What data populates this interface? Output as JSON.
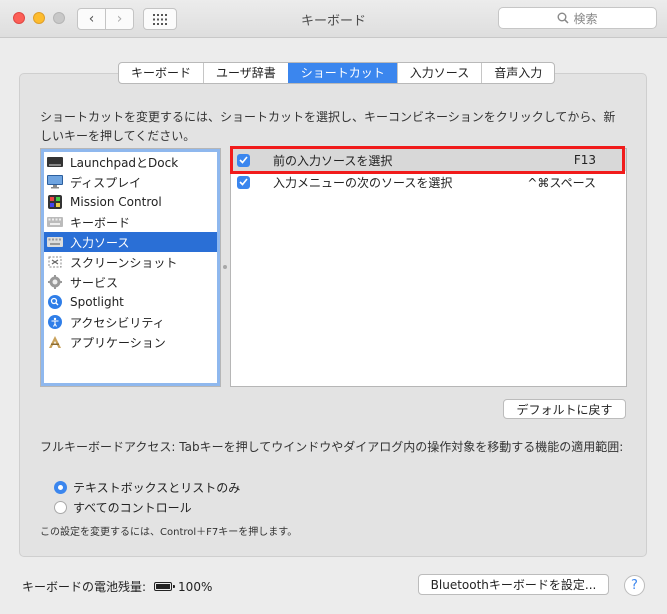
{
  "window": {
    "title": "キーボード",
    "search_placeholder": "検索",
    "nav_back": "‹",
    "nav_forward": "›"
  },
  "tabs": [
    {
      "label": "キーボード",
      "active": false
    },
    {
      "label": "ユーザ辞書",
      "active": false
    },
    {
      "label": "ショートカット",
      "active": true
    },
    {
      "label": "入力ソース",
      "active": false
    },
    {
      "label": "音声入力",
      "active": false
    }
  ],
  "description": "ショートカットを変更するには、ショートカットを選択し、キーコンビネーションをクリックしてから、新しいキーを押してください。",
  "categories": [
    {
      "label": "LaunchpadとDock",
      "icon": "launchpad-icon"
    },
    {
      "label": "ディスプレイ",
      "icon": "display-icon"
    },
    {
      "label": "Mission Control",
      "icon": "mission-control-icon"
    },
    {
      "label": "キーボード",
      "icon": "keyboard-icon"
    },
    {
      "label": "入力ソース",
      "icon": "input-source-icon",
      "selected": true
    },
    {
      "label": "スクリーンショット",
      "icon": "screenshot-icon"
    },
    {
      "label": "サービス",
      "icon": "services-gear-icon"
    },
    {
      "label": "Spotlight",
      "icon": "spotlight-icon"
    },
    {
      "label": "アクセシビリティ",
      "icon": "accessibility-icon"
    },
    {
      "label": "アプリケーション",
      "icon": "applications-icon"
    }
  ],
  "shortcuts": [
    {
      "name": "前の入力ソースを選択",
      "key": "F13",
      "checked": true
    },
    {
      "name": "入力メニューの次のソースを選択",
      "key": "^⌘スペース",
      "checked": true
    }
  ],
  "restore_defaults_label": "デフォルトに戻す",
  "full_keyboard_access": {
    "label": "フルキーボードアクセス: Tabキーを押してウインドウやダイアログ内の操作対象を移動する機能の適用範囲:",
    "options": [
      {
        "label": "テキストボックスとリストのみ",
        "selected": true
      },
      {
        "label": "すべてのコントロール",
        "selected": false
      }
    ],
    "hint": "この設定を変更するには、Control＋F7キーを押します。"
  },
  "battery": {
    "label": "キーボードの電池残量:",
    "value": "100%",
    "level": 1.0
  },
  "bluetooth_button_label": "Bluetoothキーボードを設定...",
  "help_label": "?",
  "colors": {
    "accent": "#3b86ee",
    "selection": "#2a6fd6",
    "highlight_box": "#f11b1b"
  }
}
